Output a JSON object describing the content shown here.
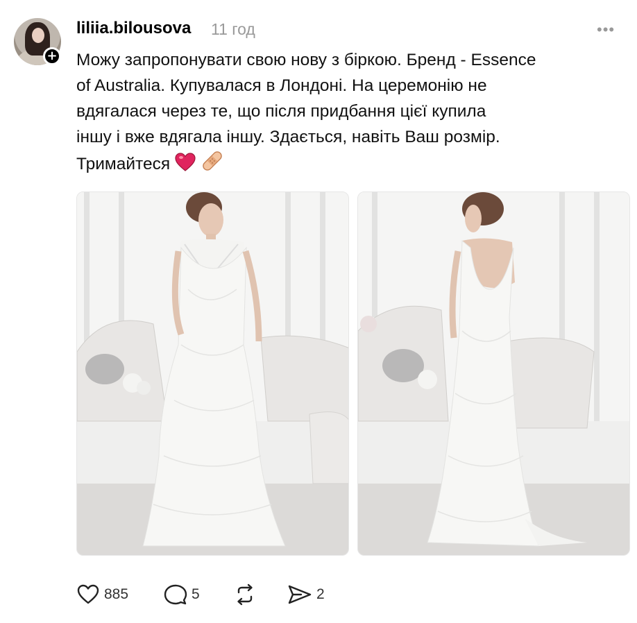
{
  "post": {
    "author": "liliia.bilousova",
    "time": "11 год",
    "text_lines": [
      "Можу запропонувати свою нову з біркою. Бренд - Essence",
      "of Australia. Купувалася в Лондоні. На церемонію не",
      "вдягалася через те, що після придбання цієї купила",
      "іншу і вже вдягала іншу. Здається, навіть Ваш розмір.",
      "Тримайтеся"
    ],
    "emojis": [
      "heart-emoji",
      "bandage-emoji"
    ]
  },
  "actions": {
    "likes": "885",
    "comments": "5",
    "shares": "2"
  },
  "icons": {
    "more": "more-options-icon",
    "like": "heart-icon",
    "comment": "comment-icon",
    "repost": "repost-icon",
    "share": "send-icon",
    "follow": "plus-icon"
  },
  "colors": {
    "text": "#111111",
    "muted": "#999999",
    "heart": "#e0245e"
  }
}
